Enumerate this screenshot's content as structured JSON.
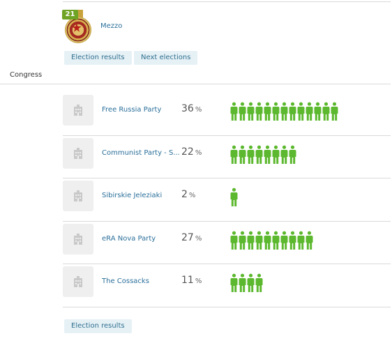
{
  "club": {
    "name": "Mezzo",
    "rank": "21"
  },
  "club_links": {
    "results": "Election results",
    "next": "Next elections"
  },
  "section": {
    "title": "Congress"
  },
  "parties": [
    {
      "name": "Free Russia Party",
      "percent": "36",
      "seats": 13
    },
    {
      "name": "Communist Party - S...",
      "percent": "22",
      "seats": 8
    },
    {
      "name": "Sibirskie Jeleziaki",
      "percent": "2",
      "seats": 1
    },
    {
      "name": "eRA Nova Party",
      "percent": "27",
      "seats": 10
    },
    {
      "name": "The Cossacks",
      "percent": "11",
      "seats": 4
    }
  ],
  "percent_unit": "%",
  "footer": {
    "results": "Election results"
  },
  "colors": {
    "seat_green": "#5cb82e",
    "link_blue": "#2a6f9a",
    "pill_bg": "#e6f1f6",
    "rank_green": "#6fa323"
  },
  "icons": {
    "party_placeholder": "building-icon",
    "seat": "person-icon",
    "club_badge": "medal-icon"
  }
}
